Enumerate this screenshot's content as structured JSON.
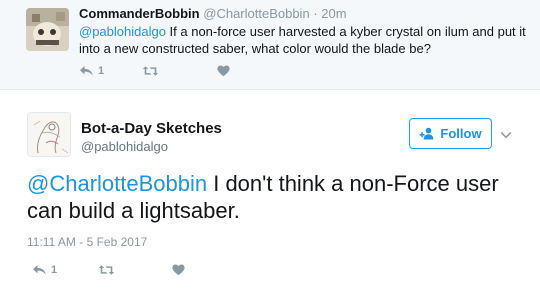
{
  "parent_tweet": {
    "author_name": "CommanderBobbin",
    "author_handle": "@CharlotteBobbin",
    "separator": "·",
    "time": "20m",
    "mention": "@pablohidalgo",
    "text": " If a non-force user harvested a kyber crystal on ilum and put it into a new constructed saber, what color would the blade be?",
    "reply_count": "1",
    "retweet_count": "",
    "like_count": ""
  },
  "main_tweet": {
    "author_name": "Bot-a-Day Sketches",
    "author_handle": "@pablohidalgo",
    "follow_label": "Follow",
    "mention": "@CharlotteBobbin",
    "text": " I don't think a non-Force user can build a lightsaber.",
    "timestamp": "11:11 AM - 5 Feb 2017",
    "reply_count": "1",
    "retweet_count": "",
    "like_count": ""
  },
  "icons": {
    "reply": "reply-icon",
    "retweet": "retweet-icon",
    "like": "heart-icon",
    "follow": "add-user-icon",
    "more": "chevron-down-icon"
  },
  "colors": {
    "accent": "#1da1f2",
    "link": "#1b95e0",
    "muted": "#8899a6",
    "parent_background": "#f5f8fa"
  }
}
